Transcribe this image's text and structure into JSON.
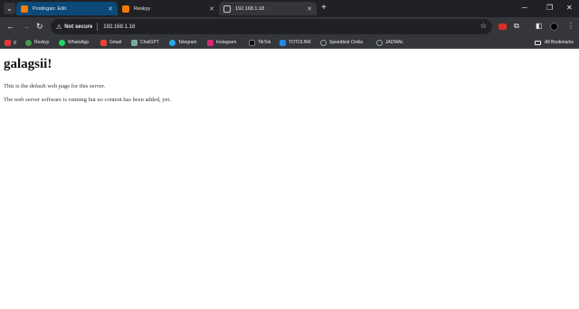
{
  "tabs": [
    {
      "title": "Postingan: Edit",
      "active": false
    },
    {
      "title": "Reskyy",
      "active": false
    },
    {
      "title": "192.168.1.18",
      "active": true
    }
  ],
  "toolbar": {
    "security_label": "Not secure",
    "url": "192.168.1.18"
  },
  "bookmarks": [
    {
      "label": "g",
      "color": "#e53935"
    },
    {
      "label": "Reskyy",
      "color": "#43a047"
    },
    {
      "label": "WhatsApp",
      "color": "#25d366"
    },
    {
      "label": "Gmail",
      "color": "#ea4335"
    },
    {
      "label": "ChatGPT",
      "color": "#74aa9c"
    },
    {
      "label": "Telegram",
      "color": "#29a9eb"
    },
    {
      "label": "Instagram",
      "color": "#d62976"
    },
    {
      "label": "TikTok",
      "color": "#111111"
    },
    {
      "label": "TOTOLINK",
      "color": "#1e88e5"
    },
    {
      "label": "Speedtest Ookla",
      "color": "#9aa0a6"
    },
    {
      "label": "JADWAL",
      "color": "#9aa0a6"
    }
  ],
  "all_bookmarks_label": "All Bookmarks",
  "page": {
    "heading": "galagsii!",
    "paragraph1": "This is the default web page for this server.",
    "paragraph2": "The web server software is running but no content has been added, yet."
  },
  "colors": {
    "tab_strip": "#202124",
    "toolbar": "#35363a",
    "active_tab": "#35363a",
    "first_tab": "#0b4a78"
  }
}
